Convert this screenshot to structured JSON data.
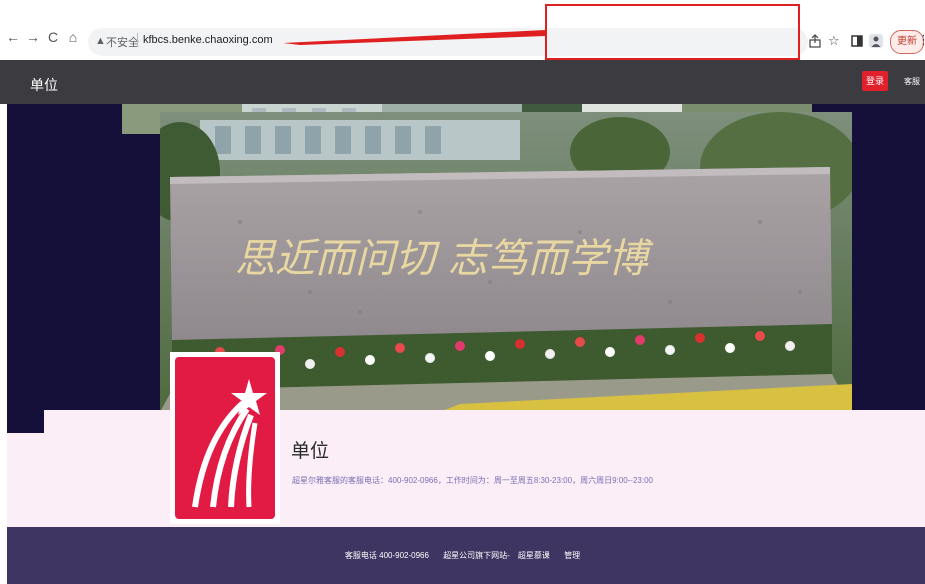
{
  "browser": {
    "nav": {
      "back": "←",
      "forward": "→",
      "reload": "C",
      "home": "⌂"
    },
    "security_icon": "▲",
    "security_label": "不安全",
    "url": "kfbcs.benke.chaoxing.com",
    "toolbar_icons": [
      "share-icon",
      "star-icon",
      "sidebar-icon",
      "profile-icon"
    ],
    "update_label": "更新",
    "menu_icon": "⋮"
  },
  "site": {
    "title": "单位",
    "login_label": "登录",
    "service_label": "客服"
  },
  "banner": {
    "motto": "思近而问切  志笃而学博"
  },
  "unit": {
    "name": "单位",
    "description": "超星尔雅客服的客服电话：400-902-0966，工作时间为：周一至周五8:30-23:00，周六周日9:00--23:00"
  },
  "footer": {
    "hotline": "客服电话 400-902-0966",
    "links_label": "超星公司旗下网站-",
    "mooc_link": "超星慕课",
    "admin_link": "管理"
  },
  "colors": {
    "header_bg": "#3b3b40",
    "login_red": "#e0202b",
    "banner_dark": "#15103a",
    "panel_pink": "#fbeef7",
    "footer_purple": "#3f3562",
    "annotation_red": "#e02020"
  }
}
